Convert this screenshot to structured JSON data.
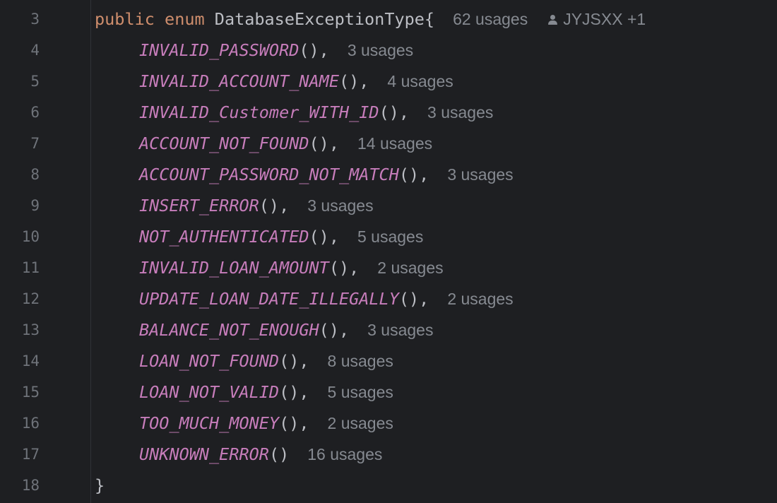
{
  "editor": {
    "header_line": {
      "number": "3",
      "kw_public": "public",
      "kw_enum": "enum",
      "type_name": "DatabaseExceptionType",
      "open_brace": "{",
      "usages": "62 usages",
      "author": "JYJSXX +1",
      "author_icon": "person-icon"
    },
    "constants": [
      {
        "number": "4",
        "name": "INVALID_PASSWORD",
        "suffix": "(),",
        "usages": "3 usages"
      },
      {
        "number": "5",
        "name": "INVALID_ACCOUNT_NAME",
        "suffix": "(),",
        "usages": "4 usages"
      },
      {
        "number": "6",
        "name": "INVALID_Customer_WITH_ID",
        "suffix": "(),",
        "usages": "3 usages"
      },
      {
        "number": "7",
        "name": "ACCOUNT_NOT_FOUND",
        "suffix": "(),",
        "usages": "14 usages"
      },
      {
        "number": "8",
        "name": "ACCOUNT_PASSWORD_NOT_MATCH",
        "suffix": "(),",
        "usages": "3 usages"
      },
      {
        "number": "9",
        "name": "INSERT_ERROR",
        "suffix": "(),",
        "usages": "3 usages"
      },
      {
        "number": "10",
        "name": "NOT_AUTHENTICATED",
        "suffix": "(),",
        "usages": "5 usages"
      },
      {
        "number": "11",
        "name": "INVALID_LOAN_AMOUNT",
        "suffix": "(),",
        "usages": "2 usages"
      },
      {
        "number": "12",
        "name": "UPDATE_LOAN_DATE_ILLEGALLY",
        "suffix": "(),",
        "usages": "2 usages"
      },
      {
        "number": "13",
        "name": "BALANCE_NOT_ENOUGH",
        "suffix": "(),",
        "usages": "3 usages"
      },
      {
        "number": "14",
        "name": "LOAN_NOT_FOUND",
        "suffix": "(),",
        "usages": "8 usages"
      },
      {
        "number": "15",
        "name": "LOAN_NOT_VALID",
        "suffix": "(),",
        "usages": "5 usages"
      },
      {
        "number": "16",
        "name": "TOO_MUCH_MONEY",
        "suffix": "(),",
        "usages": "2 usages"
      },
      {
        "number": "17",
        "name": "UNKNOWN_ERROR",
        "suffix": "()",
        "usages": "16 usages"
      }
    ],
    "closing_line": {
      "number": "18",
      "brace": "}"
    },
    "colors": {
      "background": "#1e1f22",
      "keyword": "#cf8e6d",
      "enum_constant": "#c77dbb",
      "plain": "#bcbec4",
      "hint": "#868a91",
      "line_number": "#6f737a"
    }
  }
}
